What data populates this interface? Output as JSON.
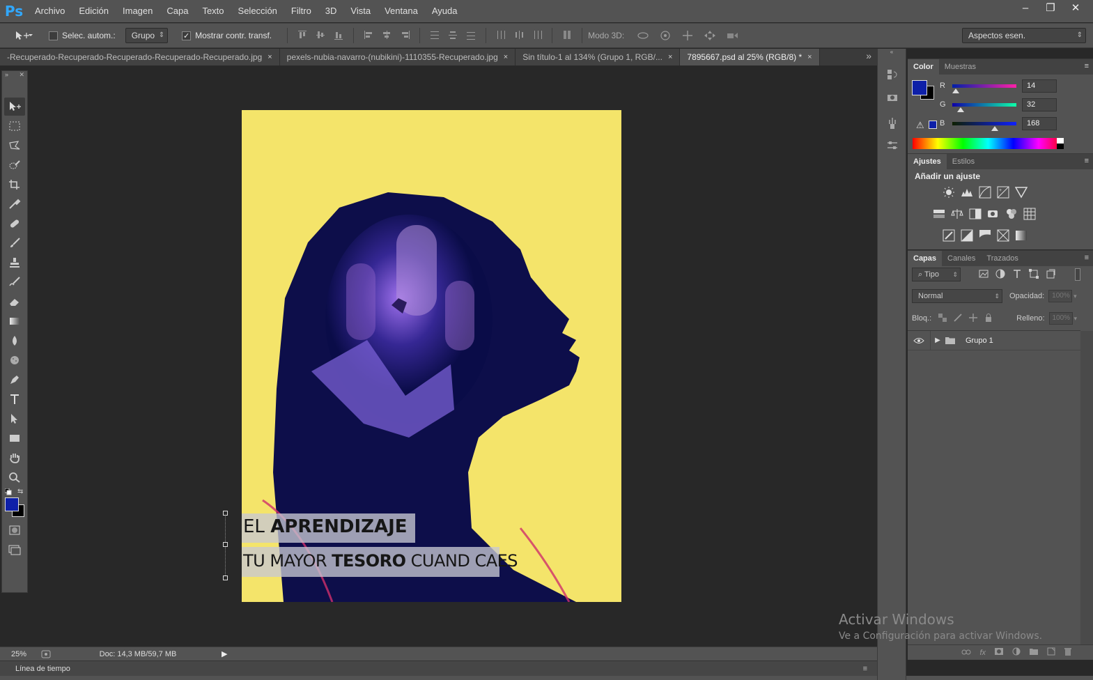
{
  "app": {
    "logo": "Ps"
  },
  "menu": [
    "Archivo",
    "Edición",
    "Imagen",
    "Capa",
    "Texto",
    "Selección",
    "Filtro",
    "3D",
    "Vista",
    "Ventana",
    "Ayuda"
  ],
  "window": {
    "minimize": "–",
    "restore": "❐",
    "close": "✕"
  },
  "options": {
    "auto_select_label": "Selec. autom.:",
    "auto_select_value": "Grupo",
    "show_transform_label": "Mostrar contr. transf.",
    "mode3d_label": "Modo 3D:",
    "workspace": "Aspectos esen."
  },
  "tabs": [
    {
      "label": "-Recuperado-Recuperado-Recuperado-Recuperado-Recuperado.jpg",
      "close": "×"
    },
    {
      "label": "pexels-nubia-navarro-(nubikini)-1110355-Recuperado.jpg",
      "close": "×"
    },
    {
      "label": "Sin título-1 al 134% (Grupo 1, RGB/...",
      "close": "×"
    },
    {
      "label": "7895667.psd al 25% (RGB/8) *",
      "close": "×"
    }
  ],
  "tab_overflow": "»",
  "poster": {
    "line1_a": "EL ",
    "line1_b": "APRENDIZAJE",
    "line2_a": "TU MAYOR ",
    "line2_b": "TESORO",
    "line2_c": " CUAND CAES"
  },
  "status": {
    "zoom": "25%",
    "doc_info": "Doc: 14,3 MB/59,7 MB",
    "timeline": "Línea de tiempo"
  },
  "color_panel": {
    "tabs": [
      "Color",
      "Muestras"
    ],
    "r_label": "R",
    "g_label": "G",
    "b_label": "B",
    "r": 14,
    "g": 32,
    "b": 168,
    "r_value": "14",
    "g_value": "32",
    "b_value": "168",
    "foreground": "#0e20a8",
    "background": "#000000"
  },
  "adjust_panel": {
    "tabs": [
      "Ajustes",
      "Estilos"
    ],
    "title": "Añadir un ajuste"
  },
  "layers_panel": {
    "tabs": [
      "Capas",
      "Canales",
      "Trazados"
    ],
    "filter": "Tipo",
    "blend_mode": "Normal",
    "opacity_label": "Opacidad:",
    "opacity_value": "100%",
    "lock_label": "Bloq.:",
    "fill_label": "Relleno:",
    "fill_value": "100%",
    "layers": [
      {
        "name": "Grupo 1"
      }
    ]
  },
  "watermark": {
    "title": "Activar Windows",
    "subtitle": "Ve a Configuración para activar Windows."
  }
}
